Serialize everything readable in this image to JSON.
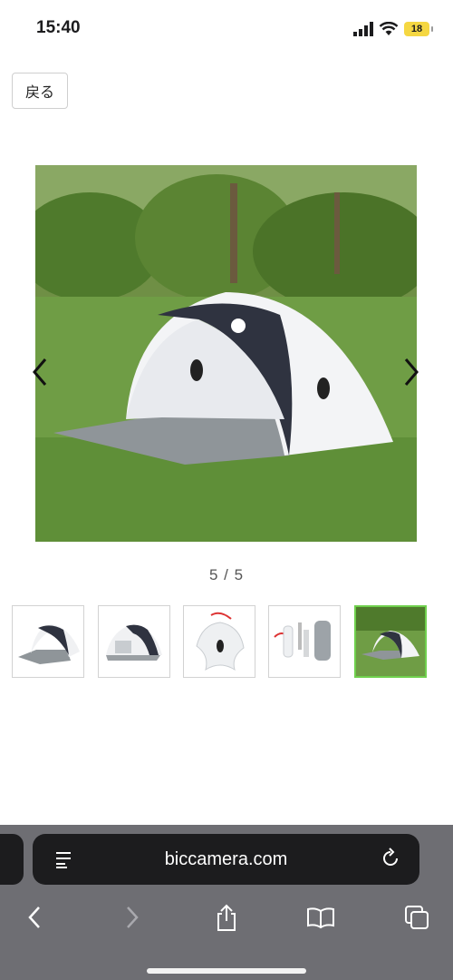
{
  "status_bar": {
    "time": "15:40",
    "battery": "18"
  },
  "page": {
    "back_label": "戻る",
    "main_image_icon": "tent-photo",
    "counter": "5 / 5",
    "thumbnails": [
      {
        "icon": "tent-front-thumbnail"
      },
      {
        "icon": "tent-side-thumbnail"
      },
      {
        "icon": "tent-bag-thumbnail"
      },
      {
        "icon": "tent-parts-thumbnail"
      },
      {
        "icon": "tent-on-grass-thumbnail",
        "selected": true
      }
    ]
  },
  "browser": {
    "url": "biccamera.com",
    "toolbar_icons": [
      "back-icon",
      "forward-icon",
      "share-icon",
      "bookmarks-icon",
      "tabs-icon"
    ]
  },
  "colors": {
    "accent_selected": "#6fd04d",
    "browser_bar": "#6e6e73",
    "url_field": "#1c1c1e"
  }
}
